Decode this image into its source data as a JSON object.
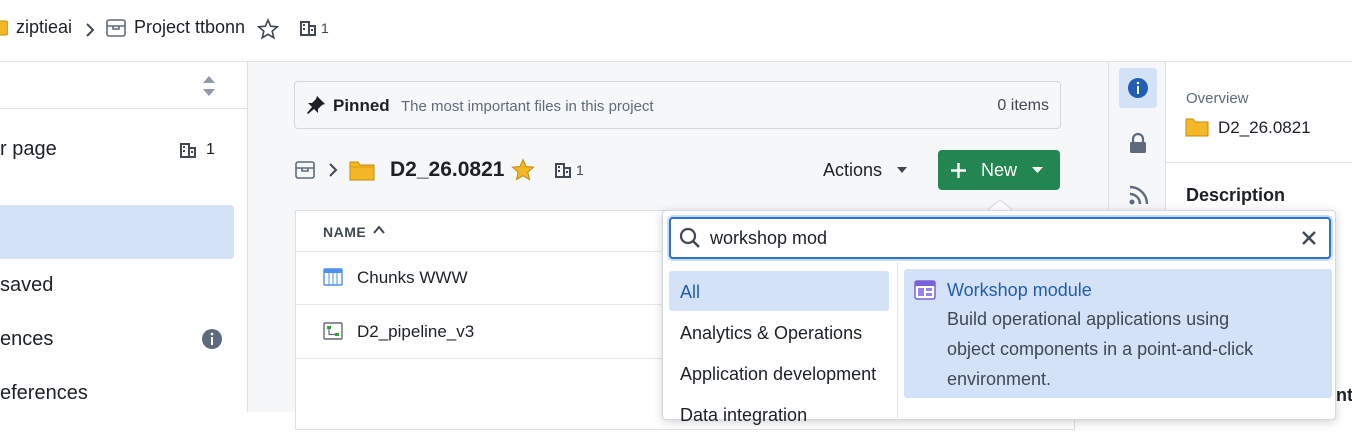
{
  "breadcrumb": {
    "org": "ziptieai",
    "project": "Project ttbonn",
    "org_count": "1"
  },
  "sidebar": {
    "items": [
      {
        "label": "r page",
        "count": "1"
      },
      {
        "label": ""
      },
      {
        "label": "saved"
      },
      {
        "label": "ences"
      },
      {
        "label": "eferences"
      }
    ]
  },
  "pinned": {
    "title": "Pinned",
    "subtitle": "The most important files in this project",
    "count": "0 items"
  },
  "folder": {
    "name": "D2_26.0821",
    "share_count": "1",
    "actions_label": "Actions",
    "new_label": "New"
  },
  "table": {
    "column_name": "NAME",
    "rows": [
      {
        "name": "Chunks WWW",
        "icon": "table-icon"
      },
      {
        "name": "D2_pipeline_v3",
        "icon": "pipeline-icon"
      }
    ]
  },
  "new_menu": {
    "search_value": "workshop mod",
    "categories": [
      {
        "label": "All",
        "selected": true
      },
      {
        "label": "Analytics & Operations"
      },
      {
        "label": "Application development"
      },
      {
        "label": "Data integration"
      }
    ],
    "results": [
      {
        "title": "Workshop module",
        "description_lines": [
          "Build operational applications using",
          "object components in a point-and-click",
          "environment."
        ],
        "icon": "workshop-icon"
      }
    ]
  },
  "right_panel": {
    "overview_label": "Overview",
    "folder_name": "D2_26.0821",
    "description_label": "Description",
    "partial_text": "nt"
  },
  "colors": {
    "accent": "#2d72d2",
    "new_button": "#238551",
    "selected_bg": "#d3e2f6",
    "folder": "#f4b826"
  }
}
